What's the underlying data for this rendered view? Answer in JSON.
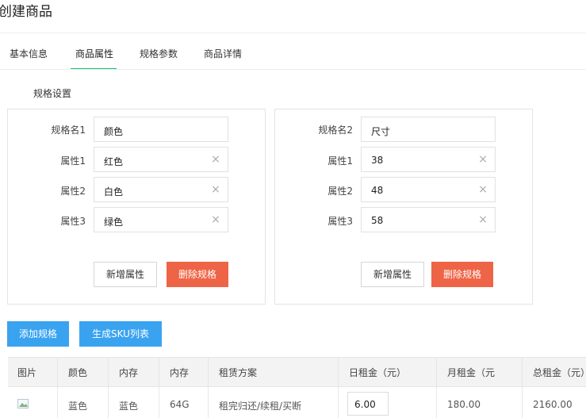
{
  "page": {
    "title": "创建商品"
  },
  "tabs": [
    "基本信息",
    "商品属性",
    "规格参数",
    "商品详情"
  ],
  "section_title": "规格设置",
  "spec_groups": [
    {
      "name_label": "规格名1",
      "name_value": "颜色",
      "attributes": [
        {
          "label": "属性1",
          "value": "红色"
        },
        {
          "label": "属性2",
          "value": "白色"
        },
        {
          "label": "属性3",
          "value": "绿色"
        }
      ],
      "add_attr_label": "新增属性",
      "delete_spec_label": "删除规格"
    },
    {
      "name_label": "规格名2",
      "name_value": "尺寸",
      "attributes": [
        {
          "label": "属性1",
          "value": "38"
        },
        {
          "label": "属性2",
          "value": "48"
        },
        {
          "label": "属性3",
          "value": "58"
        }
      ],
      "add_attr_label": "新增属性",
      "delete_spec_label": "删除规格"
    }
  ],
  "actions": {
    "add_spec": "添加规格",
    "gen_sku": "生成SKU列表"
  },
  "sku_table": {
    "headers": [
      "图片",
      "颜色",
      "内存",
      "内存",
      "租赁方案",
      "日租金（元）",
      "月租金（元",
      "总租金（元）"
    ],
    "rows": [
      {
        "color": "蓝色",
        "mem1": "蓝色",
        "mem2": "64G",
        "plan": "租完归还/续租/买断",
        "daily": "6.00",
        "monthly": "180.00",
        "total": "2160.00"
      }
    ]
  },
  "colors": {
    "active_tab": "#13c26b",
    "danger": "#ee6446",
    "primary": "#3aa3f0"
  }
}
